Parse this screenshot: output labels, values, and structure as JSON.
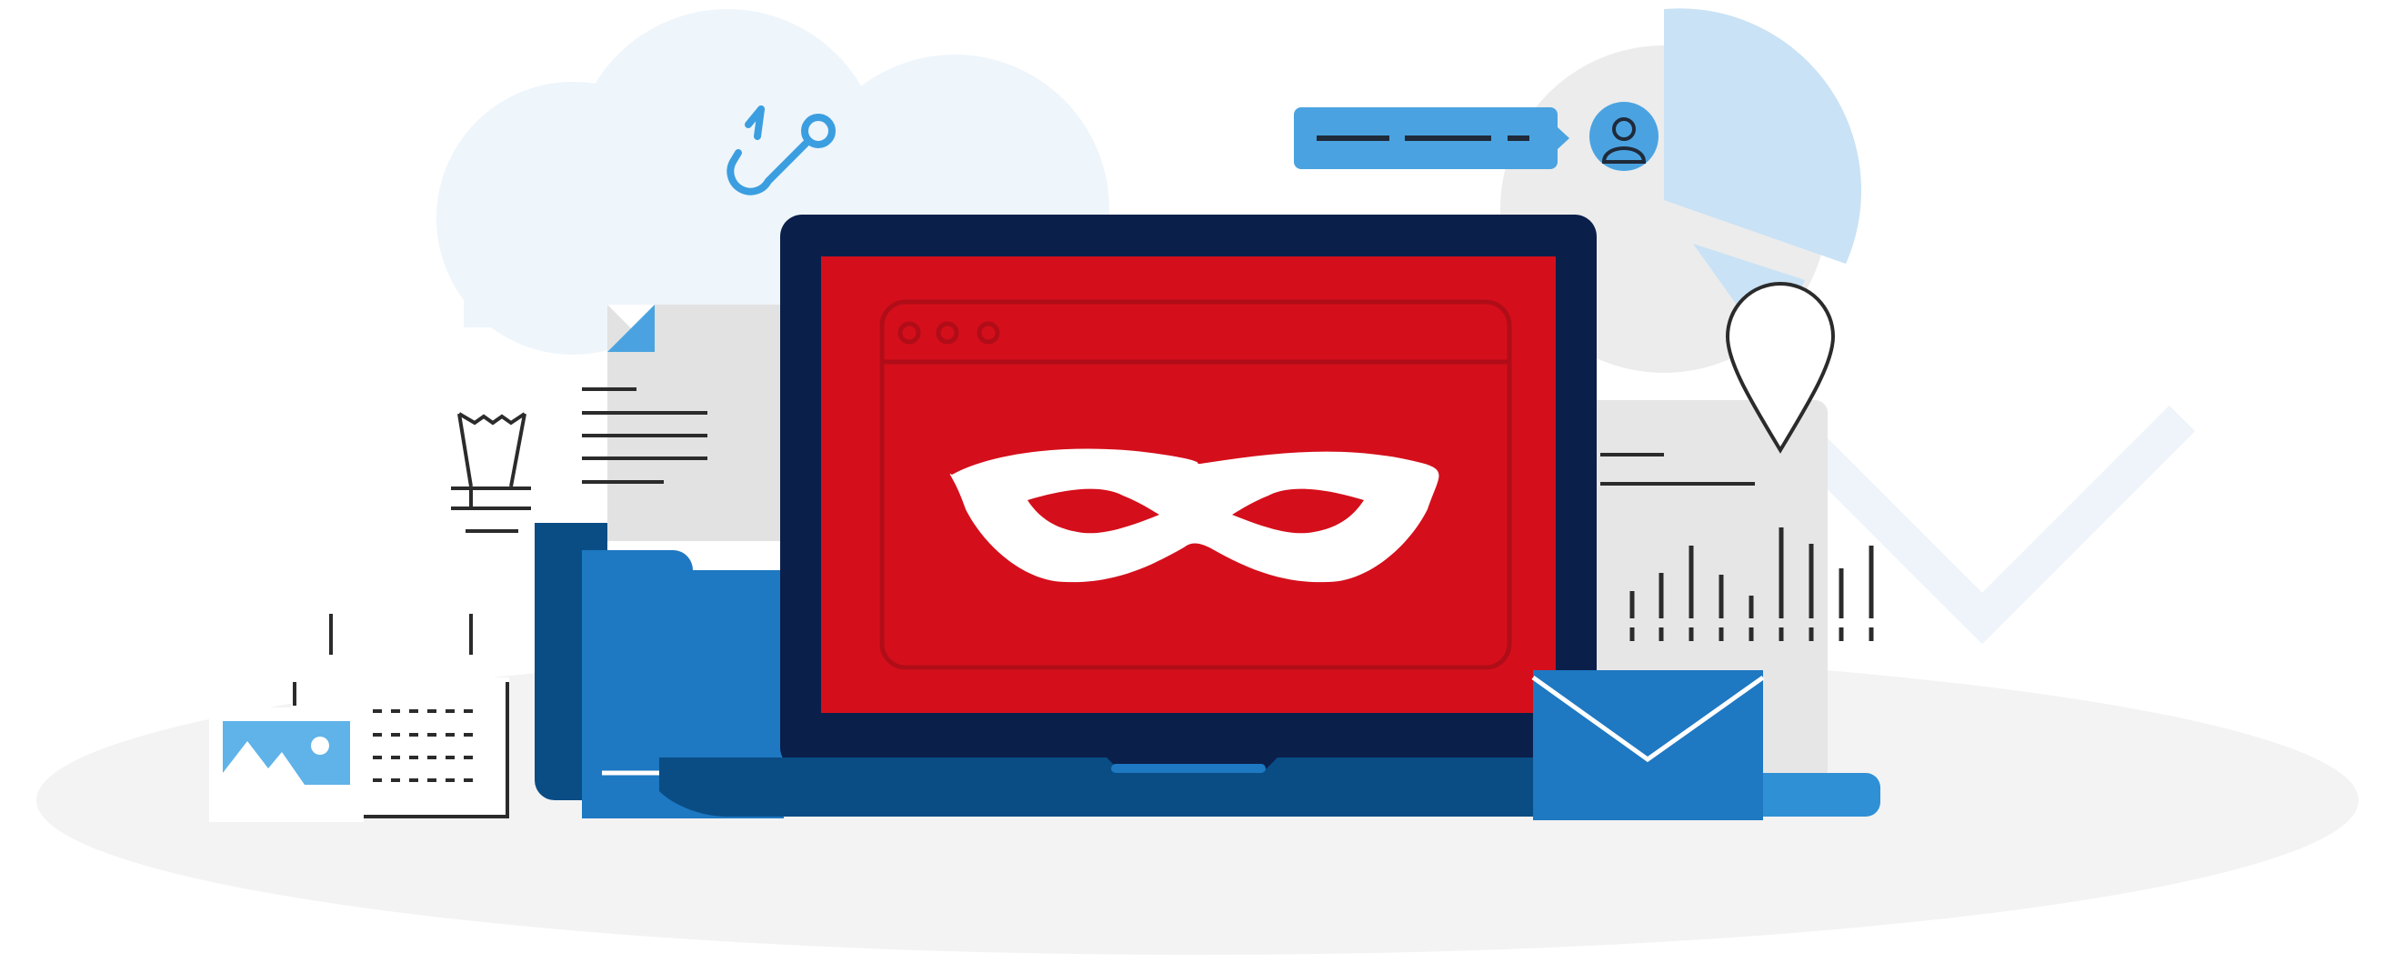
{
  "illustration": {
    "theme": "cybersecurity-phishing",
    "icons": [
      "cloud-icon",
      "fishing-hook-icon",
      "chat-bubble-icon",
      "user-avatar-icon",
      "pie-chart-icon",
      "map-pin-icon",
      "document-icon",
      "folder-icon",
      "laptop-icon",
      "browser-window-icon",
      "eye-mask-icon",
      "envelope-icon",
      "image-icon",
      "calendar-icon",
      "bar-chart-icon",
      "trash-icon"
    ],
    "colors": {
      "navy": "#0b1f4b",
      "dark_blue": "#0a4d85",
      "blue": "#1e78c2",
      "light_blue": "#4da6e0",
      "pale_blue": "#c9e2f5",
      "red": "#d40f1b",
      "dark_red": "#b00d18",
      "gray": "#e2e2e2",
      "floor": "#f3f3f3",
      "line": "#2b2b2b",
      "white": "#ffffff"
    }
  }
}
